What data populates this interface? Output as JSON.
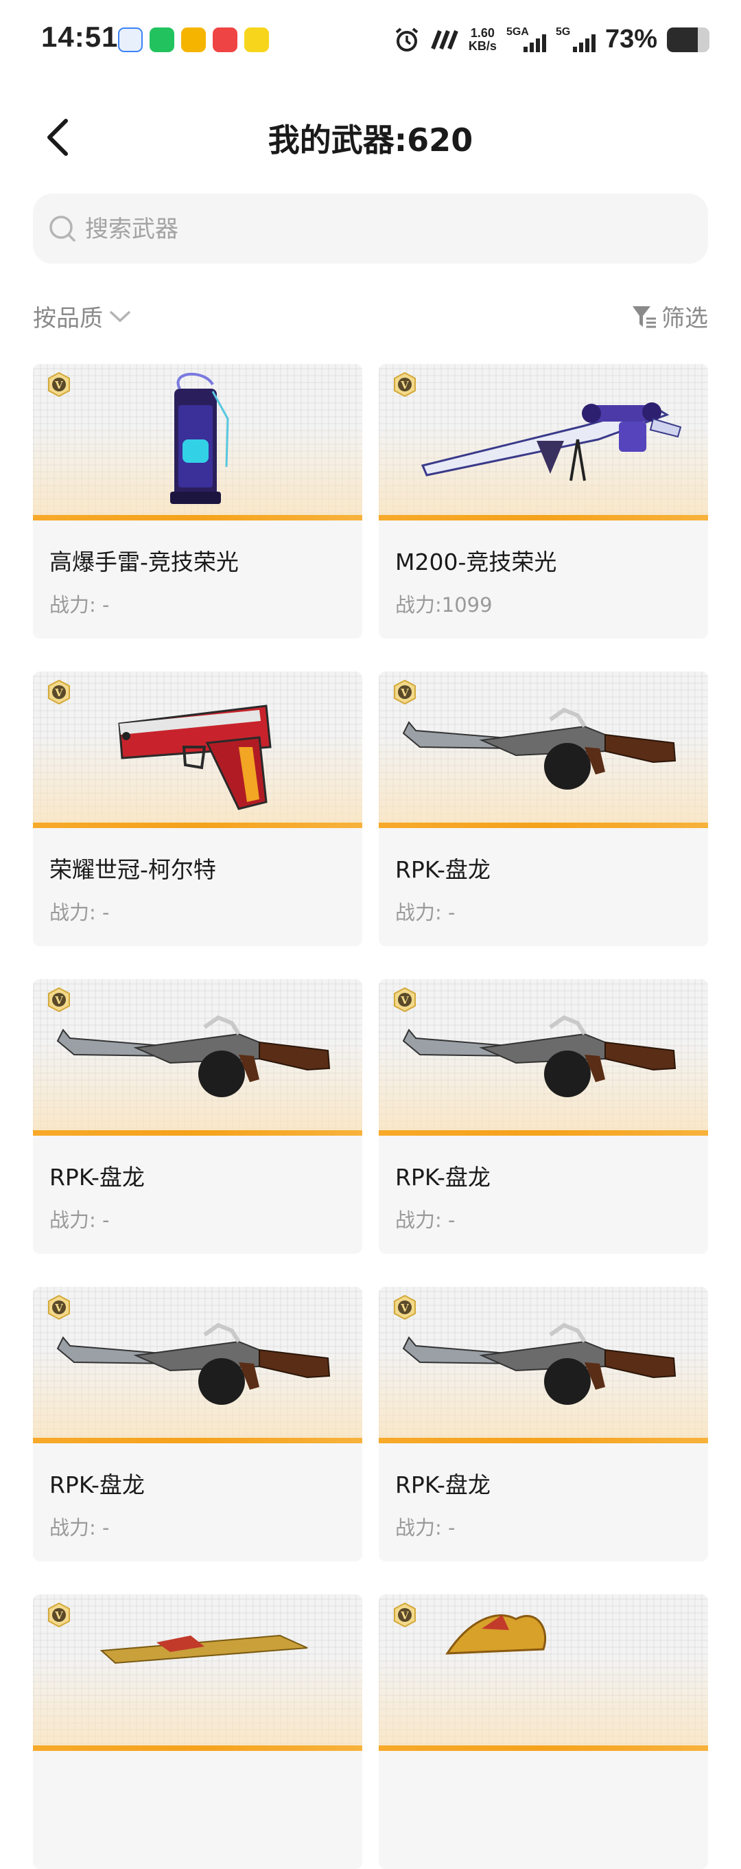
{
  "status_bar": {
    "time": "14:51",
    "speed_value": "1.60",
    "speed_unit": "KB/s",
    "net1": "5GA",
    "net2": "5G",
    "battery_text": "73%",
    "battery_level": 0.73
  },
  "header": {
    "title": "我的武器:620"
  },
  "search": {
    "placeholder": "搜索武器"
  },
  "toolbar": {
    "sort_label": "按品质",
    "filter_label": "筛选"
  },
  "weapons": [
    {
      "name": "高爆手雷-竞技荣光",
      "power": "战力: -",
      "kind": "grenade"
    },
    {
      "name": "M200-竞技荣光",
      "power": "战力:1099",
      "kind": "sniper"
    },
    {
      "name": "荣耀世冠-柯尔特",
      "power": "战力: -",
      "kind": "pistol"
    },
    {
      "name": "RPK-盘龙",
      "power": "战力: -",
      "kind": "rifle"
    },
    {
      "name": "RPK-盘龙",
      "power": "战力: -",
      "kind": "rifle"
    },
    {
      "name": "RPK-盘龙",
      "power": "战力: -",
      "kind": "rifle"
    },
    {
      "name": "RPK-盘龙",
      "power": "战力: -",
      "kind": "rifle"
    },
    {
      "name": "RPK-盘龙",
      "power": "战力: -",
      "kind": "rifle"
    },
    {
      "name": "",
      "power": "",
      "kind": "gold-rifle"
    },
    {
      "name": "",
      "power": "",
      "kind": "gold-dragon"
    }
  ]
}
